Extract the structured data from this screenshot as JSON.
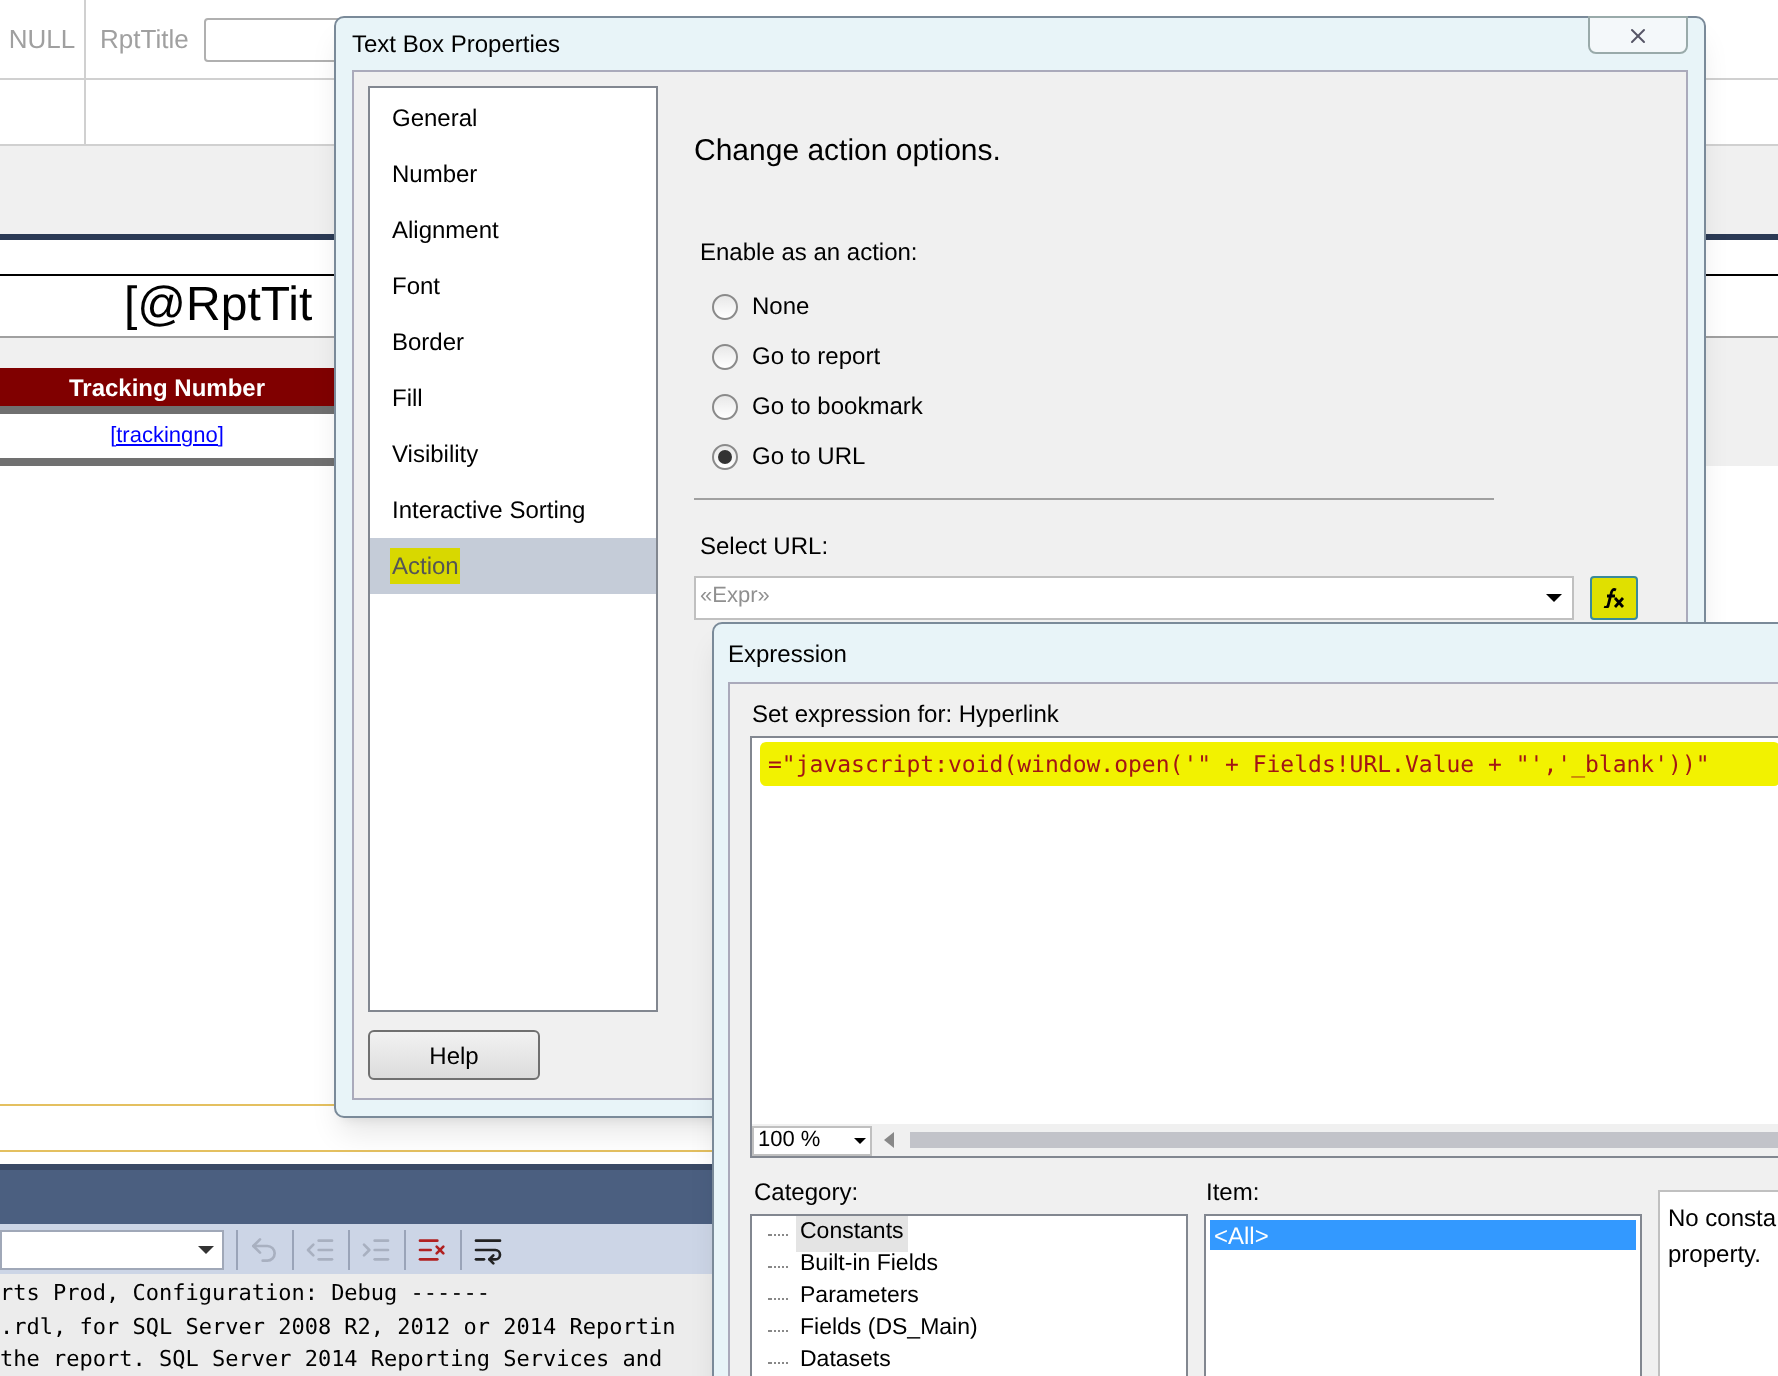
{
  "designer": {
    "parameter_row": {
      "value_label": "NULL",
      "name_label": "RptTitle"
    },
    "report_title": "[@RptTit",
    "table": {
      "header": "Tracking Number",
      "cell": "[trackingno]"
    },
    "output_toolbar": {
      "buttons": [
        {
          "kind": "goto",
          "disabled": true
        },
        {
          "kind": "outdent",
          "disabled": true
        },
        {
          "kind": "indent",
          "disabled": true
        },
        {
          "kind": "clear",
          "disabled": false
        },
        {
          "kind": "wrap",
          "disabled": false
        }
      ]
    },
    "output_lines": [
      "rts Prod, Configuration: Debug ------",
      ".rdl, for SQL Server 2008 R2, 2012 or 2014 Reportin",
      "the report. SQL Server 2014 Reporting Services and"
    ]
  },
  "properties_dialog": {
    "title": "Text Box Properties",
    "nav": [
      {
        "label": "General",
        "selected": false
      },
      {
        "label": "Number",
        "selected": false
      },
      {
        "label": "Alignment",
        "selected": false
      },
      {
        "label": "Font",
        "selected": false
      },
      {
        "label": "Border",
        "selected": false
      },
      {
        "label": "Fill",
        "selected": false
      },
      {
        "label": "Visibility",
        "selected": false
      },
      {
        "label": "Interactive Sorting",
        "selected": false
      },
      {
        "label": "Action",
        "selected": true
      }
    ],
    "heading": "Change action options.",
    "enable_label": "Enable as an action:",
    "options": [
      {
        "label": "None",
        "selected": false
      },
      {
        "label": "Go to report",
        "selected": false
      },
      {
        "label": "Go to bookmark",
        "selected": false
      },
      {
        "label": "Go to URL",
        "selected": true
      }
    ],
    "url_label": "Select URL:",
    "url_value": "«Expr»",
    "help_button": "Help"
  },
  "expression_dialog": {
    "title": "Expression",
    "set_for": "Set expression for: Hyperlink",
    "expression": "=\"javascript:void(window.open('\" + Fields!URL.Value + \"','_blank'))\"",
    "zoom": "100 %",
    "category_label": "Category:",
    "categories": [
      {
        "label": "Constants",
        "selected": true
      },
      {
        "label": "Built-in Fields",
        "selected": false
      },
      {
        "label": "Parameters",
        "selected": false
      },
      {
        "label": "Fields (DS_Main)",
        "selected": false
      },
      {
        "label": "Datasets",
        "selected": false
      }
    ],
    "item_label": "Item:",
    "items": [
      {
        "label": "<All>",
        "selected": true
      }
    ],
    "description": [
      "No consta",
      "property."
    ]
  }
}
